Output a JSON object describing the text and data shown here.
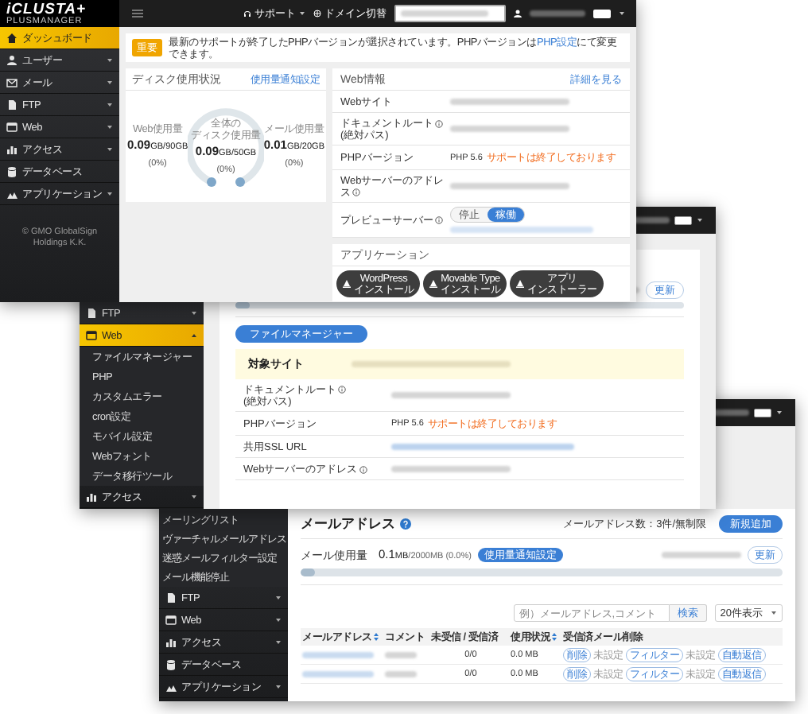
{
  "dashboard_window": {
    "logo": {
      "text": "iCLUSTA+",
      "subtext": "PLUSMANAGER"
    },
    "header": {
      "support": "サポート",
      "domain_switch": "ドメイン切替"
    },
    "sidebar": {
      "items": [
        {
          "label": "ダッシュボード",
          "selected": true,
          "expandable": false
        },
        {
          "label": "ユーザー",
          "selected": false,
          "expandable": true,
          "expanded": false
        },
        {
          "label": "メール",
          "selected": false,
          "expandable": true,
          "expanded": false
        },
        {
          "label": "FTP",
          "selected": false,
          "expandable": true,
          "expanded": false
        },
        {
          "label": "Web",
          "selected": false,
          "expandable": true,
          "expanded": false
        },
        {
          "label": "アクセス",
          "selected": false,
          "expandable": true,
          "expanded": false
        },
        {
          "label": "データベース",
          "selected": false,
          "expandable": false
        },
        {
          "label": "アプリケーション",
          "selected": false,
          "expandable": true,
          "expanded": false
        }
      ],
      "copyright": "© GMO GlobalSign Holdings K.K."
    },
    "notice": {
      "badge": "重要",
      "text": "最新のサポートが終了したPHPバージョンが選択されています。PHPバージョンは",
      "link": "PHP設定",
      "text_after": "にて変更できます。"
    },
    "disk_usage": {
      "title": "ディスク使用状況",
      "link": "使用量通知設定",
      "meters": [
        {
          "kind": "side",
          "label_lines": [
            "Web使用量"
          ],
          "value": "0.09",
          "unit": "GB",
          "total": "/90GB",
          "percent": "(0%)"
        },
        {
          "kind": "gauge",
          "label_lines": [
            "全体の",
            "ディスク使用量"
          ],
          "value": "0.09",
          "unit": "GB",
          "total": "/50GB",
          "percent": "(0%)"
        },
        {
          "kind": "side",
          "label_lines": [
            "メール使用量"
          ],
          "value": "0.01",
          "unit": "GB",
          "total": "/20GB",
          "percent": "(0%)"
        }
      ]
    },
    "web_info": {
      "title": "Web情報",
      "link": "詳細を見る",
      "rows": [
        {
          "kind": "redacted",
          "label": "Webサイト",
          "info": false
        },
        {
          "kind": "redacted",
          "label": "ドキュメントルート",
          "sublabel": "(絶対パス)",
          "info": true
        },
        {
          "kind": "php",
          "label": "PHPバージョン",
          "info": false,
          "value": "PHP 5.6",
          "warning": "サポートは終了しております"
        },
        {
          "kind": "redacted",
          "label": "Webサーバーのアドレス",
          "info": true
        },
        {
          "kind": "toggle",
          "label": "プレビューサーバー",
          "info": true,
          "options": [
            {
              "label": "停止",
              "selected": false
            },
            {
              "label": "稼働",
              "selected": true
            }
          ]
        }
      ]
    },
    "applications": {
      "title": "アプリケーション",
      "buttons": [
        {
          "lines": [
            "WordPress",
            "インストール"
          ]
        },
        {
          "lines": [
            "Movable Type",
            "インストール"
          ]
        },
        {
          "lines": [
            "アプリ",
            "インストーラー"
          ]
        }
      ]
    }
  },
  "web_window": {
    "sidebar": {
      "items": [
        {
          "label": "FTP",
          "selected": false,
          "expandable": true,
          "expanded": false
        },
        {
          "label": "Web",
          "selected": true,
          "expandable": true,
          "expanded": true,
          "children": [
            {
              "label": "ファイルマネージャー"
            },
            {
              "label": "PHP"
            },
            {
              "label": "カスタムエラー"
            },
            {
              "label": "cron設定"
            },
            {
              "label": "モバイル設定"
            },
            {
              "label": "Webフォント"
            },
            {
              "label": "データ移行ツール"
            }
          ]
        },
        {
          "label": "アクセス",
          "selected": false,
          "expandable": true,
          "expanded": false
        }
      ]
    },
    "update_button": "更新",
    "progress": {
      "level": 0
    },
    "file_manager_button": "ファイルマネージャー",
    "target_site": {
      "title": "対象サイト"
    },
    "rows": [
      {
        "kind": "redacted",
        "label": "ドキュメントルート",
        "sublabel": "(絶対パス)",
        "info": true
      },
      {
        "kind": "php",
        "label": "PHPバージョン",
        "info": false,
        "value": "PHP 5.6",
        "warning": "サポートは終了しております"
      },
      {
        "kind": "link",
        "label": "共用SSL URL",
        "info": false
      },
      {
        "kind": "redacted",
        "label": "Webサーバーのアドレス",
        "info": true
      }
    ]
  },
  "mail_window": {
    "sidebar": {
      "submenu": [
        {
          "label": "メーリングリスト"
        },
        {
          "label": "ヴァーチャルメールアドレス"
        },
        {
          "label": "迷惑メールフィルター設定"
        },
        {
          "label": "メール機能停止"
        }
      ],
      "items": [
        {
          "label": "FTP",
          "selected": false,
          "expandable": true,
          "expanded": false
        },
        {
          "label": "Web",
          "selected": false,
          "expandable": true,
          "expanded": false
        },
        {
          "label": "アクセス",
          "selected": false,
          "expandable": true,
          "expanded": false
        },
        {
          "label": "データベース",
          "selected": false,
          "expandable": false
        },
        {
          "label": "アプリケーション",
          "selected": false,
          "expandable": true,
          "expanded": false
        }
      ]
    },
    "title": "メールアドレス",
    "count": "メールアドレス数：3件/無制限",
    "add_button": "新規追加",
    "usage": {
      "label": "メール使用量",
      "level": 0,
      "value": "0.1",
      "unit": "MB",
      "total": "/2000MB (0.0%)",
      "notify_button": "使用量通知設定",
      "update_button": "更新"
    },
    "search": {
      "placeholder": "例）メールアドレス,コメント",
      "button": "検索"
    },
    "per_page": "20件表示",
    "table": {
      "columns": [
        {
          "label": "メールアドレス",
          "sortable": true
        },
        {
          "label": "コメント",
          "sortable": false
        },
        {
          "label": "未受信 / 受信済",
          "sortable": false
        },
        {
          "label": "使用状況",
          "sortable": true
        },
        {
          "label": "受信済メール削除",
          "sortable": false
        }
      ],
      "rows": [
        {
          "received": "0/0",
          "usage": "0.0 MB",
          "delete": "削除",
          "filter_status": "未設定",
          "filter": "フィルター",
          "reply_status": "未設定",
          "reply": "自動返信"
        },
        {
          "received": "0/0",
          "usage": "0.0 MB",
          "delete": "削除",
          "filter_status": "未設定",
          "filter": "フィルター",
          "reply_status": "未設定",
          "reply": "自動返信"
        }
      ]
    }
  }
}
